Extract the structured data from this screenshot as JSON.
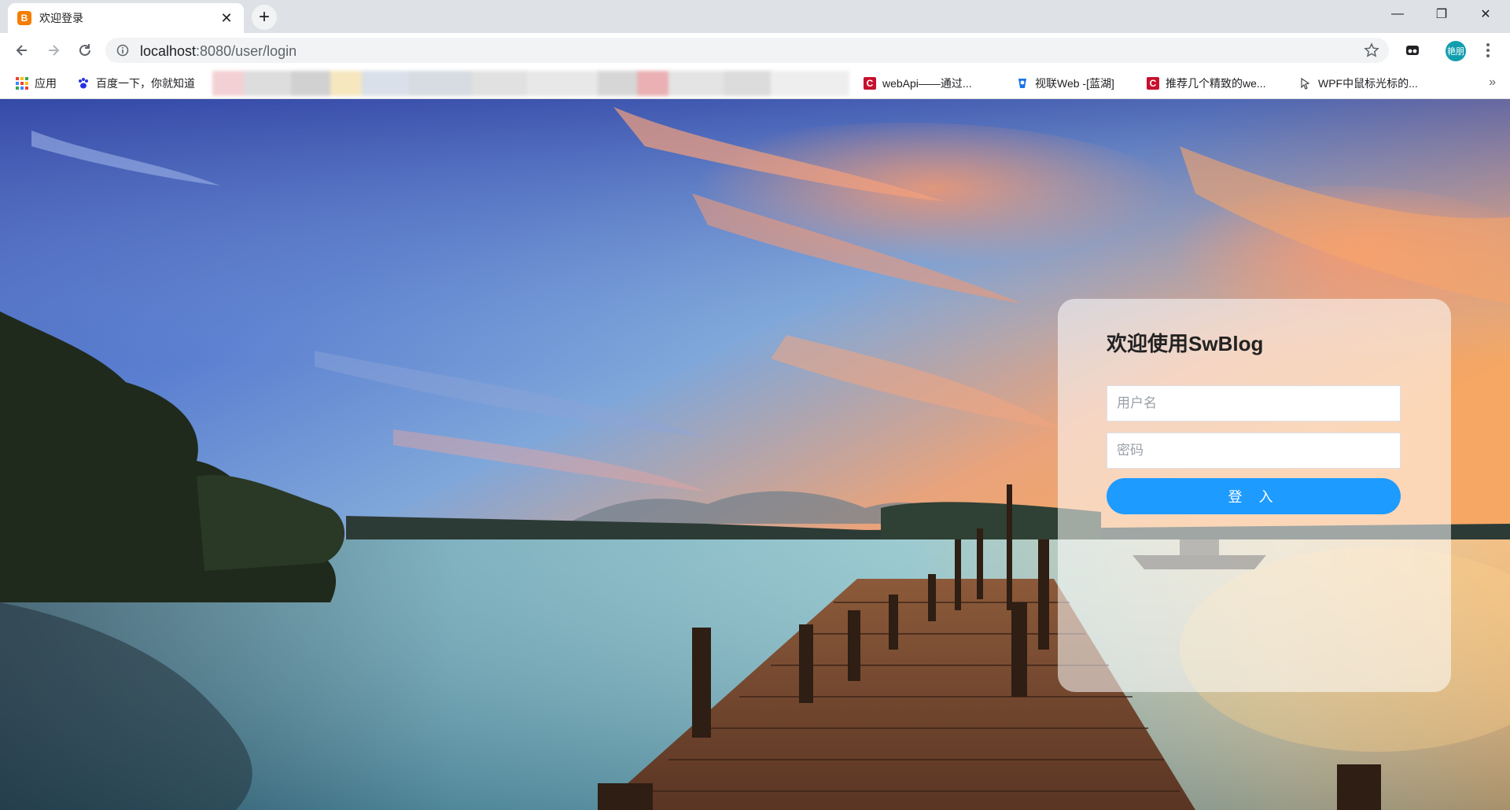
{
  "browser": {
    "tab": {
      "title": "欢迎登录",
      "favicon_letter": "B",
      "close": "✕"
    },
    "new_tab": "+",
    "window_controls": {
      "minimize": "—",
      "restore": "❐",
      "close": "✕"
    },
    "url": {
      "host": "localhost",
      "rest": ":8080/user/login"
    },
    "avatar_text": "艳朋",
    "bookmarks": [
      {
        "label": "应用",
        "icon": "apps-grid-icon"
      },
      {
        "label": "百度一下，你就知道",
        "icon": "baidu-paw-icon"
      },
      {
        "label": "webApi——通过...",
        "icon": "csdn-icon"
      },
      {
        "label": "视联Web -[蓝湖]",
        "icon": "lanhu-icon"
      },
      {
        "label": "推荐几个精致的we...",
        "icon": "csdn-icon"
      },
      {
        "label": "WPF中鼠标光标的...",
        "icon": "cursor-icon"
      }
    ],
    "bookmarks_more": "»"
  },
  "login": {
    "title": "欢迎使用SwBlog",
    "username_placeholder": "用户名",
    "password_placeholder": "密码",
    "submit_label": "登 入"
  },
  "colors": {
    "primary_button": "#1e9bff",
    "tab_strip": "#dee1e6",
    "omnibox": "#f1f3f4",
    "avatar": "#129eaf"
  }
}
